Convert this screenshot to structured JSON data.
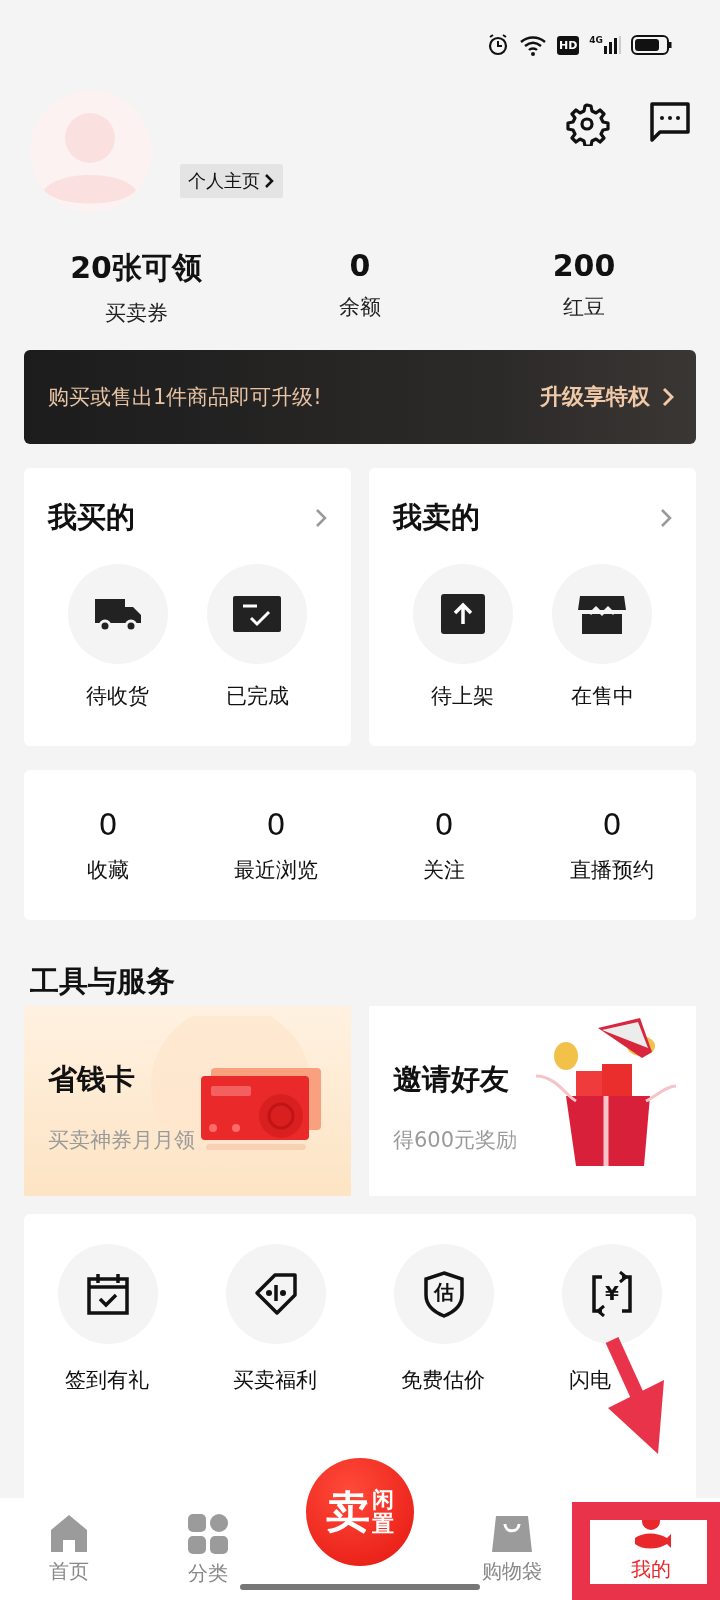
{
  "status_bar": {
    "hd_badge": "HD",
    "network": "4G"
  },
  "profile": {
    "homepage_link": "个人主页"
  },
  "stats": [
    {
      "value": "20张可领",
      "label": "买卖券"
    },
    {
      "value": "0",
      "label": "余额"
    },
    {
      "value": "200",
      "label": "红豆"
    }
  ],
  "upgrade_banner": {
    "text": "购买或售出1件商品即可升级!",
    "action": "升级享特权"
  },
  "order_cards": [
    {
      "title": "我买的",
      "items": [
        {
          "label": "待收货",
          "kind": "truck"
        },
        {
          "label": "已完成",
          "kind": "check"
        }
      ]
    },
    {
      "title": "我卖的",
      "items": [
        {
          "label": "待上架",
          "kind": "upload"
        },
        {
          "label": "在售中",
          "kind": "store"
        }
      ]
    }
  ],
  "counters": [
    {
      "value": "0",
      "label": "收藏"
    },
    {
      "value": "0",
      "label": "最近浏览"
    },
    {
      "value": "0",
      "label": "关注"
    },
    {
      "value": "0",
      "label": "直播预约"
    }
  ],
  "tools_section": {
    "title": "工具与服务",
    "promos": [
      {
        "title": "省钱卡",
        "subtitle": "买卖神券月月领",
        "kind": "card"
      },
      {
        "title": "邀请好友",
        "subtitle": "得600元奖励",
        "kind": "gift"
      }
    ]
  },
  "services": [
    {
      "label": "签到有礼",
      "kind": "calendar"
    },
    {
      "label": "买卖福利",
      "kind": "tag"
    },
    {
      "label": "免费估价",
      "kind": "shield",
      "icon_text": "估"
    },
    {
      "label": "闪电",
      "kind": "exchange",
      "icon_text": "¥"
    }
  ],
  "tab_bar": {
    "tabs": [
      {
        "label": "首页",
        "kind": "home",
        "selected": false
      },
      {
        "label": "分类",
        "kind": "grid",
        "selected": false
      },
      {
        "label": "购物袋",
        "kind": "bag",
        "selected": false
      },
      {
        "label": "我的",
        "kind": "fish",
        "selected": true
      }
    ],
    "sell_button": {
      "main": "卖",
      "side": "闲置"
    }
  },
  "annotations": {
    "arrow": true,
    "frame": true
  }
}
